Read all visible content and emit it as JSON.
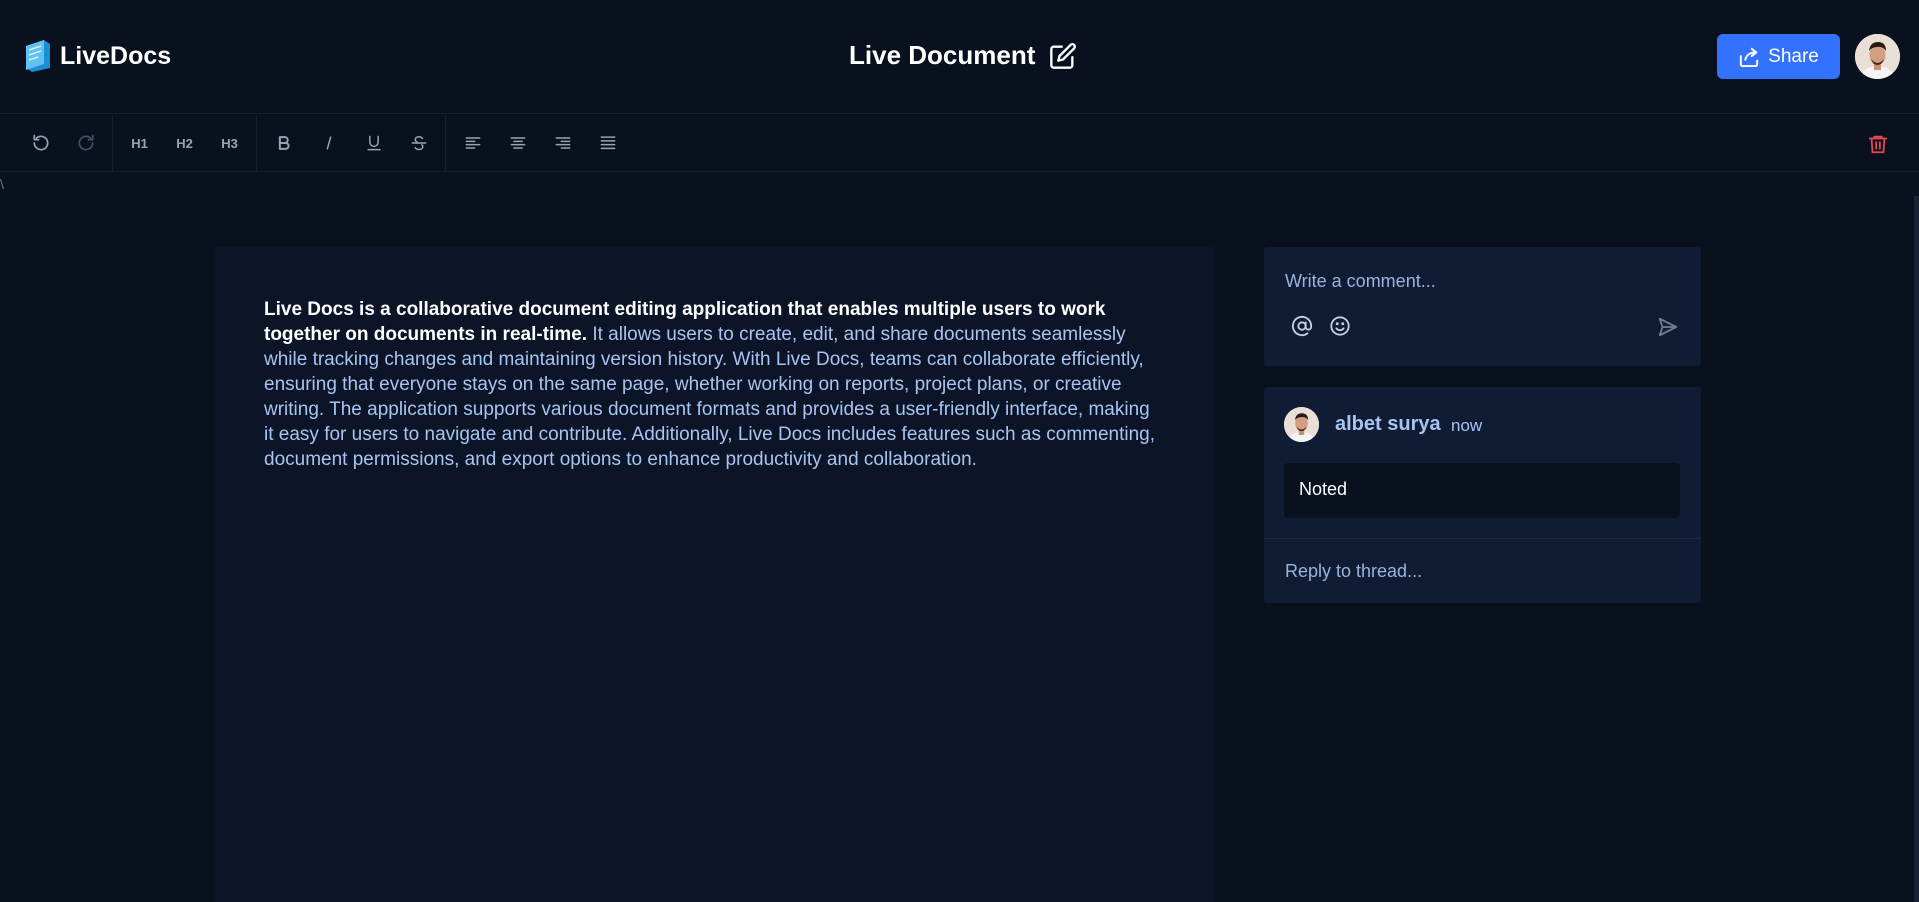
{
  "app": {
    "name": "LiveDocs"
  },
  "document": {
    "title": "Live Document"
  },
  "header": {
    "share_label": "Share"
  },
  "toolbar": {
    "history": [
      {
        "name": "undo-icon",
        "enabled": true
      },
      {
        "name": "redo-icon",
        "enabled": false
      }
    ],
    "headings": [
      "H1",
      "H2",
      "H3"
    ],
    "format": [
      "bold-icon",
      "italic-icon",
      "underline-icon",
      "strikethrough-icon"
    ],
    "align": [
      "align-left-icon",
      "align-center-icon",
      "align-right-icon",
      "align-justify-icon"
    ],
    "delete_icon": "trash-icon"
  },
  "stray_text": "\\",
  "editor": {
    "bold_text": "Live Docs is a collaborative document editing application that enables multiple users to work together on documents in real-time.",
    "body_text": " It allows users to create, edit, and share documents seamlessly while tracking changes and maintaining version history. With Live Docs, teams can collaborate efficiently, ensuring that everyone stays on the same page, whether working on reports, project plans, or creative writing. The application supports various document formats and provides a user-friendly interface, making it easy for users to navigate and contribute. Additionally, Live Docs includes features such as commenting, document permissions, and export options to enhance productivity and collaboration."
  },
  "composer": {
    "placeholder": "Write a comment..."
  },
  "thread": {
    "author": "albet surya",
    "time": "now",
    "message": "Noted",
    "reply_placeholder": "Reply to thread..."
  },
  "colors": {
    "background": "#09111f",
    "accent": "#3371ff",
    "panel": "#0f1c33",
    "danger": "#e5484d"
  }
}
